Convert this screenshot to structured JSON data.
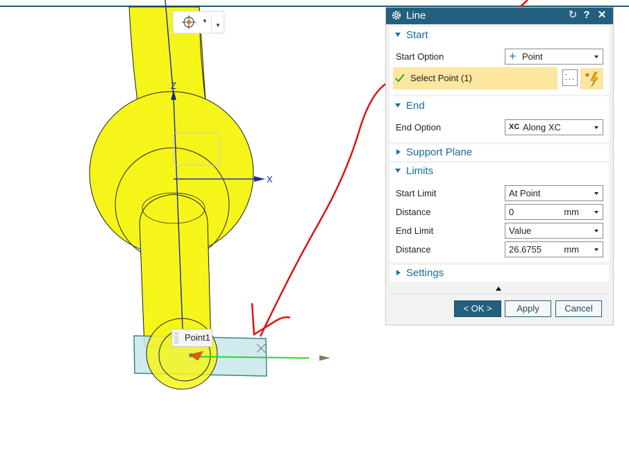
{
  "viewport": {
    "axis_z_label": "Z",
    "axis_x_label": "X",
    "point_label": "Point1",
    "model_color": "#f5f51a",
    "plane_color": "#c8e8ea"
  },
  "snap_toolbar": {
    "icon": "snap-point-icon"
  },
  "dialog": {
    "title": "Line",
    "title_buttons": [
      "reset-icon",
      "help-icon",
      "close-icon"
    ],
    "start": {
      "header": "Start",
      "option_label": "Start Option",
      "option_value": "Point",
      "select_point": "Select Point (1)"
    },
    "end": {
      "header": "End",
      "option_label": "End Option",
      "option_prefix": "XC",
      "option_value": "Along XC"
    },
    "support_plane": {
      "header": "Support Plane"
    },
    "limits": {
      "header": "Limits",
      "start_limit_label": "Start Limit",
      "start_limit_value": "At Point",
      "distance1_label": "Distance",
      "distance1_value": "0",
      "distance1_unit": "mm",
      "end_limit_label": "End Limit",
      "end_limit_value": "Value",
      "distance2_label": "Distance",
      "distance2_value": "26.6755",
      "distance2_unit": "mm"
    },
    "settings": {
      "header": "Settings"
    },
    "buttons": {
      "ok": "< OK >",
      "apply": "Apply",
      "cancel": "Cancel"
    },
    "accent_color": "#23607f",
    "highlight_color": "#fce6a0"
  }
}
